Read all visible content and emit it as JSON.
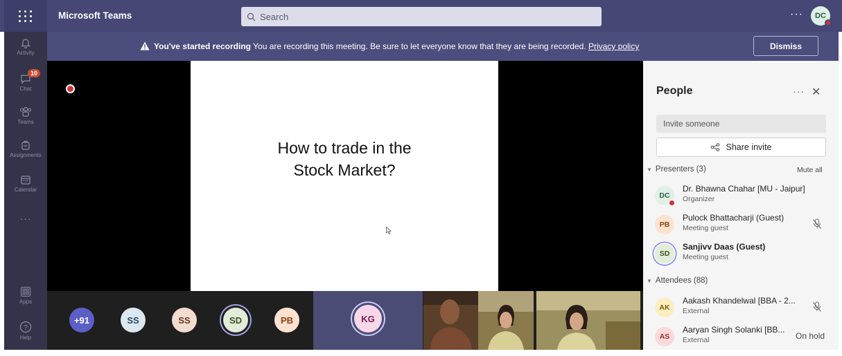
{
  "app": {
    "title": "Microsoft Teams",
    "search_placeholder": "Search",
    "more_label": "···",
    "user_initials": "DC"
  },
  "rail": {
    "items": [
      {
        "label": "Activity"
      },
      {
        "label": "Chat",
        "badge": "10"
      },
      {
        "label": "Teams"
      },
      {
        "label": "Assignments"
      },
      {
        "label": "Calendar"
      },
      {
        "label": "···"
      },
      {
        "label": "Apps"
      },
      {
        "label": "Help"
      }
    ]
  },
  "banner": {
    "bold": "You've started recording",
    "text": " You are recording this meeting. Be sure to let everyone know that they are being recorded. ",
    "link": "Privacy policy",
    "dismiss_label": "Dismiss"
  },
  "stage": {
    "slide_line1": "How to trade in the",
    "slide_line2": "Stock Market?"
  },
  "strip": {
    "avatars": [
      {
        "label": "+91",
        "bg": "#5b5fc7",
        "fg": "#ffffff"
      },
      {
        "label": "SS",
        "bg": "#dbe8f1",
        "fg": "#2a4a63"
      },
      {
        "label": "SS",
        "bg": "#f2dcd0",
        "fg": "#6b3a25"
      },
      {
        "label": "SD",
        "bg": "#e3ecd8",
        "fg": "#3b5325"
      },
      {
        "label": "PB",
        "bg": "#fde3cf",
        "fg": "#8a3e0f"
      }
    ],
    "speaker": {
      "label": "KG",
      "bg": "#f8d7e8",
      "fg": "#7a1f4d"
    }
  },
  "people": {
    "title": "People",
    "more_label": "···",
    "close_label": "✕",
    "invite_placeholder": "Invite someone",
    "share_label": "Share invite",
    "presenters_label": "Presenters (3)",
    "mute_all_label": "Mute all",
    "attendees_label": "Attendees (88)",
    "presenters": [
      {
        "initials": "DC",
        "name": "Dr. Bhawna Chahar [MU - Jaipur]",
        "role": "Organizer",
        "bg": "#dff0e6",
        "fg": "#2b5b43"
      },
      {
        "initials": "PB",
        "name": "Pulock Bhattacharji (Guest)",
        "role": "Meeting guest",
        "bg": "#fde3cf",
        "fg": "#8a3e0f"
      },
      {
        "initials": "SD",
        "name": "Sanjivv Daas (Guest)",
        "role": "Meeting guest",
        "bg": "#e3ecd8",
        "fg": "#3b5325"
      }
    ],
    "attendees": [
      {
        "initials": "AK",
        "name": "Aakash Khandelwal [BBA - 2...",
        "role": "External",
        "bg": "#fbeec1",
        "fg": "#7a5a05"
      },
      {
        "initials": "AS",
        "name": "Aaryan Singh Solanki [BB...",
        "role": "External",
        "bg": "#fbd9d9",
        "fg": "#9a2a2a",
        "status": "On hold"
      }
    ]
  },
  "colors": {
    "teams_purple": "#464775",
    "banner": "#4b4d7d",
    "rail": "#33344a",
    "recording_red": "#d13438"
  }
}
